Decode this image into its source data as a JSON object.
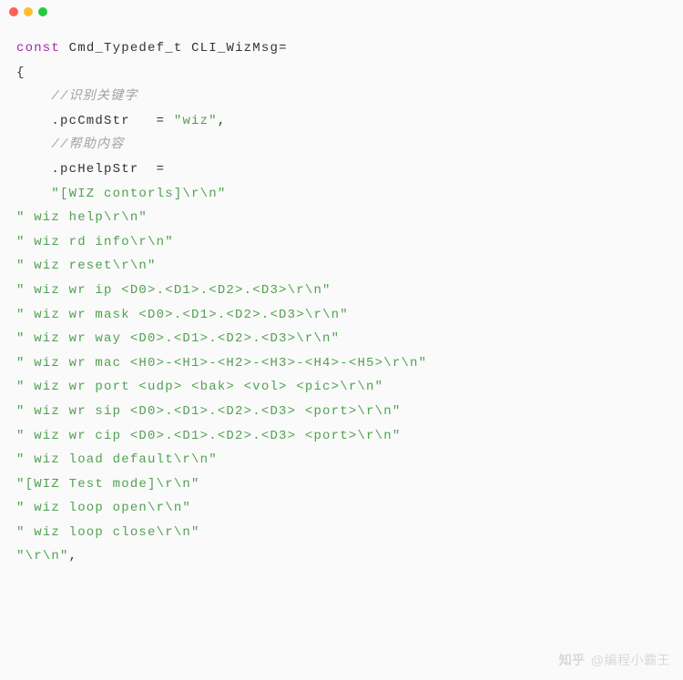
{
  "titlebar": {
    "dots": [
      "red",
      "yellow",
      "green"
    ]
  },
  "code": {
    "const_kw": "const",
    "type_token": "Cmd_Typedef_t",
    "var_token": "CLI_WizMsg",
    "eq": "=",
    "brace_open": "{",
    "comment_key": "//识别关键字",
    "field_cmd": ".pcCmdStr",
    "pad_cmd": "   ",
    "eq2": "= ",
    "str_wiz": "\"wiz\"",
    "comma": ",",
    "comment_help": "//帮助内容",
    "field_help": ".pcHelpStr",
    "pad_help": "  ",
    "eq3": "=",
    "str_head": "\"[WIZ contorls]\\r\\n\"",
    "lines": [
      "\" wiz help\\r\\n\"",
      "\" wiz rd info\\r\\n\"",
      "\" wiz reset\\r\\n\"",
      "\" wiz wr ip <D0>.<D1>.<D2>.<D3>\\r\\n\"",
      "\" wiz wr mask <D0>.<D1>.<D2>.<D3>\\r\\n\"",
      "\" wiz wr way <D0>.<D1>.<D2>.<D3>\\r\\n\"",
      "\" wiz wr mac <H0>-<H1>-<H2>-<H3>-<H4>-<H5>\\r\\n\"",
      "\" wiz wr port <udp> <bak> <vol> <pic>\\r\\n\"",
      "\" wiz wr sip <D0>.<D1>.<D2>.<D3> <port>\\r\\n\"",
      "\" wiz wr cip <D0>.<D1>.<D2>.<D3> <port>\\r\\n\"",
      "\" wiz load default\\r\\n\"",
      "\"[WIZ Test mode]\\r\\n\"",
      "\" wiz loop open\\r\\n\"",
      "\" wiz loop close\\r\\n\""
    ],
    "last": "\"\\r\\n\"",
    "last_comma": ","
  },
  "watermark": {
    "logo": "知乎",
    "at": "@编程小霸王"
  }
}
